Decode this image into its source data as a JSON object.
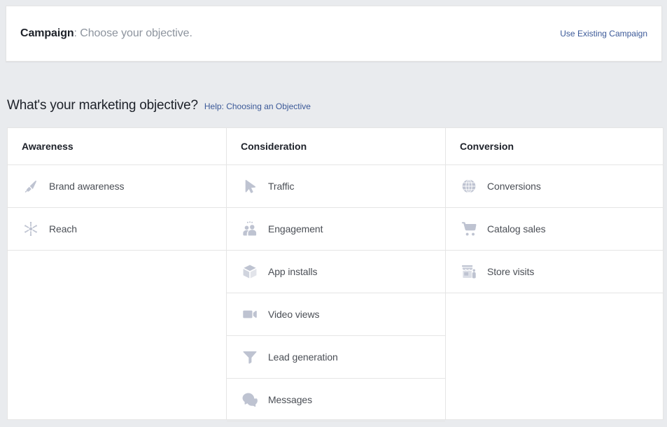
{
  "campaign_bar": {
    "label_strong": "Campaign",
    "label_rest": ": Choose your objective.",
    "use_existing_link": "Use Existing Campaign"
  },
  "objective_section": {
    "heading": "What's your marketing objective?",
    "help_link": "Help: Choosing an Objective"
  },
  "colors": {
    "page_background": "#e9ebee",
    "card_background": "#ffffff",
    "border": "#e5e5e5",
    "link": "#3b5998",
    "heading_text": "#1d2129",
    "body_text": "#4b4f56",
    "muted_text": "#8d949e",
    "icon": "#bec3d1"
  },
  "columns": [
    {
      "header": "Awareness",
      "rows": [
        {
          "label": "Brand awareness",
          "icon": "megaphone-icon"
        },
        {
          "label": "Reach",
          "icon": "reach-hub-icon"
        }
      ]
    },
    {
      "header": "Consideration",
      "rows": [
        {
          "label": "Traffic",
          "icon": "cursor-arrow-icon"
        },
        {
          "label": "Engagement",
          "icon": "people-group-icon"
        },
        {
          "label": "App installs",
          "icon": "cube-box-icon"
        },
        {
          "label": "Video views",
          "icon": "video-camera-icon"
        },
        {
          "label": "Lead generation",
          "icon": "funnel-icon"
        },
        {
          "label": "Messages",
          "icon": "chat-bubbles-icon"
        }
      ]
    },
    {
      "header": "Conversion",
      "rows": [
        {
          "label": "Conversions",
          "icon": "globe-icon"
        },
        {
          "label": "Catalog sales",
          "icon": "shopping-cart-icon"
        },
        {
          "label": "Store visits",
          "icon": "storefront-icon"
        }
      ]
    }
  ]
}
